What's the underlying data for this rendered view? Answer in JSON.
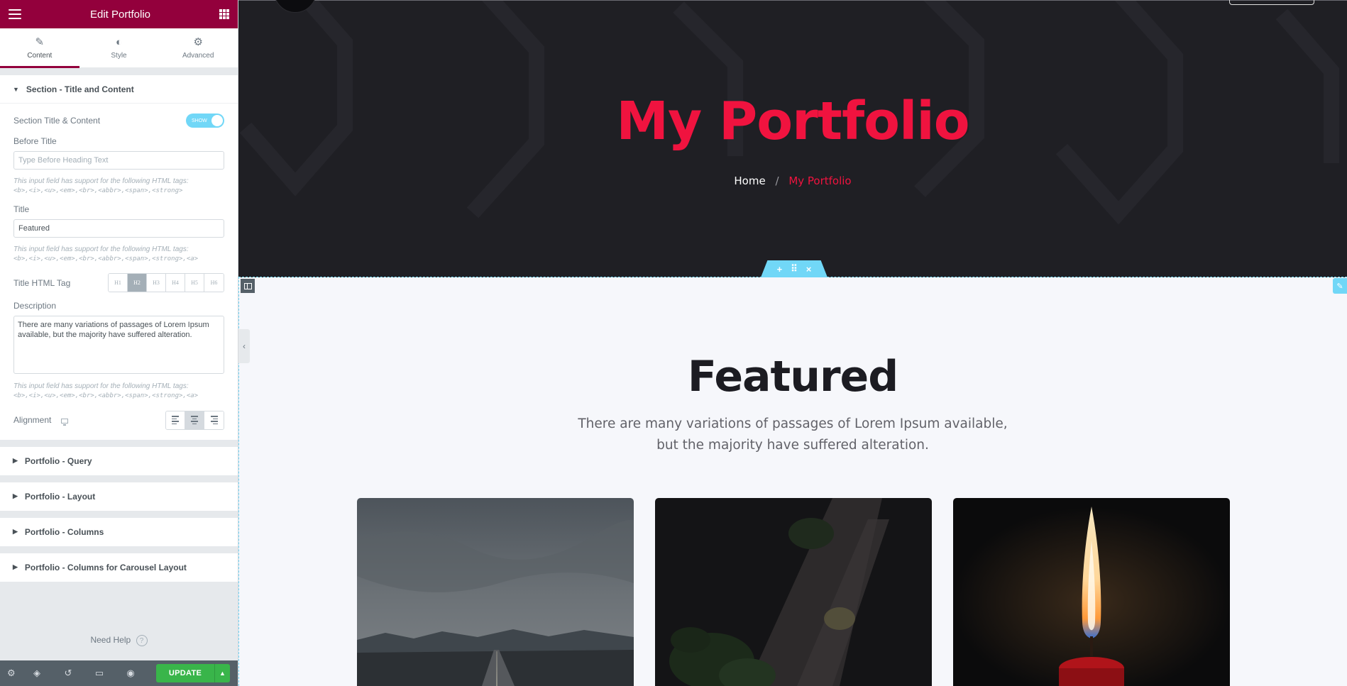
{
  "panel": {
    "title": "Edit Portfolio",
    "icons": {
      "menu": "hamburger-icon",
      "apps": "grid-icon"
    },
    "tabs": [
      {
        "label": "Content",
        "icon": "pencil-icon",
        "active": true
      },
      {
        "label": "Style",
        "icon": "half-circle-icon",
        "active": false
      },
      {
        "label": "Advanced",
        "icon": "gear-icon",
        "active": false
      }
    ],
    "section_title": {
      "heading": "Section - Title and Content",
      "toggle_label": "Section Title & Content",
      "toggle_state": "SHOW",
      "before_title_label": "Before Title",
      "before_title_placeholder": "Type Before Heading Text",
      "before_title_value": "",
      "hint_intro": "This input field has support for the following HTML tags:",
      "hint_tags_short": "<b>,<i>,<u>,<em>,<br>,<abbr>,<span>,<strong>",
      "hint_tags_long": "<b>,<i>,<u>,<em>,<br>,<abbr>,<span>,<strong>,<a>",
      "title_label": "Title",
      "title_value": "Featured",
      "html_tag_label": "Title HTML Tag",
      "html_tags": [
        "H1",
        "H2",
        "H3",
        "H4",
        "H5",
        "H6"
      ],
      "html_tag_selected": "H2",
      "description_label": "Description",
      "description_value": "There are many variations of passages of Lorem Ipsum available, but the majority have suffered alteration.",
      "alignment_label": "Alignment",
      "alignment_selected": "center"
    },
    "collapsed_sections": [
      "Portfolio - Query",
      "Portfolio - Layout",
      "Portfolio - Columns",
      "Portfolio - Columns for Carousel Layout"
    ],
    "need_help": "Need Help",
    "footer": {
      "icons": [
        "gear-icon",
        "layers-icon",
        "history-icon",
        "responsive-icon",
        "eye-icon"
      ],
      "update_label": "UPDATE"
    }
  },
  "preview": {
    "hero_title": "My Portfolio",
    "breadcrumb": {
      "home": "Home",
      "separator": "/",
      "current": "My Portfolio"
    },
    "section_handle": [
      "+",
      "⠿",
      "×"
    ],
    "featured_title": "Featured",
    "featured_desc_line1": "There are many variations of passages of Lorem Ipsum available,",
    "featured_desc_line2": "but the majority have suffered alteration.",
    "cards": [
      "road-photo",
      "plant-photo",
      "candle-photo"
    ]
  },
  "colors": {
    "panel_header": "#93003c",
    "accent_red": "#f0133f",
    "hero_bg": "#1f1f24",
    "elementor_blue": "#71d7f7",
    "update_green": "#39b54a"
  }
}
